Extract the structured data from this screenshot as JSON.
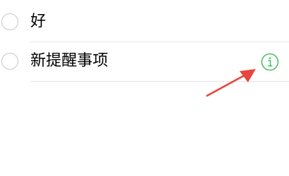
{
  "reminders": {
    "items": [
      {
        "title": "好"
      },
      {
        "title": "新提醒事项"
      }
    ]
  },
  "icons": {
    "info": "info-icon",
    "complete": "circle-icon"
  },
  "colors": {
    "info_green": "#4cc06a",
    "arrow_red": "#e8453c",
    "separator": "#e5e5ea",
    "circle_border": "#c7c7cc"
  }
}
